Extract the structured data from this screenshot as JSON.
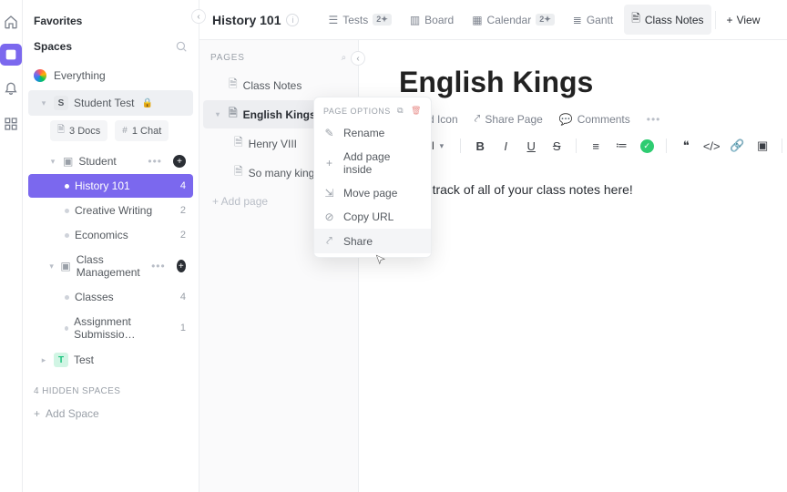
{
  "sidebar": {
    "favorites_label": "Favorites",
    "spaces_label": "Spaces",
    "everything_label": "Everything",
    "hidden_spaces_label": "4 HIDDEN SPACES",
    "add_space_label": "Add Space",
    "spaces": [
      {
        "name": "Student Test",
        "initial": "S",
        "private": true,
        "selected": true,
        "chips": {
          "docs": "3 Docs",
          "chat": "1 Chat"
        },
        "folders": [
          {
            "name": "Student",
            "lists": [
              {
                "name": "History 101",
                "count": "4",
                "selected": true
              },
              {
                "name": "Creative Writing",
                "count": "2"
              },
              {
                "name": "Economics",
                "count": "2"
              }
            ]
          },
          {
            "name": "Class Management",
            "lists": [
              {
                "name": "Classes",
                "count": "4"
              },
              {
                "name": "Assignment Submissio…",
                "count": "1"
              }
            ]
          }
        ]
      },
      {
        "name": "Test",
        "initial": "T",
        "color": "#19c37d"
      }
    ]
  },
  "header": {
    "title": "History 101",
    "tabs": [
      {
        "label": "Tests",
        "pill": "2✦",
        "icon": "list"
      },
      {
        "label": "Board",
        "icon": "board"
      },
      {
        "label": "Calendar",
        "pill": "2✦",
        "icon": "calendar"
      },
      {
        "label": "Gantt",
        "icon": "gantt"
      },
      {
        "label": "Class Notes",
        "icon": "doc",
        "active": true
      }
    ],
    "add_view_label": "View"
  },
  "pages": {
    "header": "PAGES",
    "add_label": "+ Add page",
    "items": [
      {
        "label": "Class Notes"
      },
      {
        "label": "English Kings",
        "selected": true,
        "children": [
          {
            "label": "Henry VIII"
          },
          {
            "label": "So many kings!"
          }
        ]
      }
    ]
  },
  "context_menu": {
    "header": "PAGE OPTIONS",
    "items": [
      {
        "label": "Rename",
        "icon": "pencil"
      },
      {
        "label": "Add page inside",
        "icon": "plus"
      },
      {
        "label": "Move page",
        "icon": "move"
      },
      {
        "label": "Copy URL",
        "icon": "link"
      },
      {
        "label": "Share",
        "icon": "share",
        "hover": true
      }
    ]
  },
  "doc": {
    "title": "English Kings",
    "actions": {
      "add_icon": "Add Icon",
      "share": "Share Page",
      "comments": "Comments"
    },
    "toolbar": {
      "style": "Normal"
    },
    "body": "Keep track of all of your class notes here!",
    "swatches": [
      "#ffffff",
      "#fff59d",
      "#c5e1a5",
      "#ffcdd2",
      "#e1e4e8"
    ]
  }
}
